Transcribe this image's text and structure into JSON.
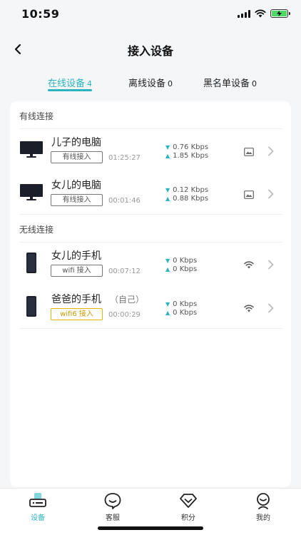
{
  "status_bar": {
    "time": "10:59"
  },
  "nav": {
    "title": "接入设备"
  },
  "tabs": [
    {
      "label": "在线设备",
      "count": "4",
      "active": true
    },
    {
      "label": "离线设备",
      "count": "0",
      "active": false
    },
    {
      "label": "黑名单设备",
      "count": "0",
      "active": false
    }
  ],
  "wired": {
    "title": "有线连接",
    "devices": [
      {
        "name": "儿子的电脑",
        "conn": "有线接入",
        "duration": "01:25:27",
        "down": "0.76 Kbps",
        "up": "1.85 Kbps",
        "icon": "desktop-icon",
        "type_icon": "picture-icon"
      },
      {
        "name": "女儿的电脑",
        "conn": "有线接入",
        "duration": "00:01:46",
        "down": "0.12 Kbps",
        "up": "0.88 Kbps",
        "icon": "desktop-icon",
        "type_icon": "picture-icon"
      }
    ]
  },
  "wireless": {
    "title": "无线连接",
    "devices": [
      {
        "name": "女儿的手机",
        "self_tag": "",
        "conn": "wifi 接入",
        "duration": "00:07:12",
        "down": "0 Kbps",
        "up": "0 Kbps",
        "icon": "phone-icon",
        "type_icon": "wifi-icon"
      },
      {
        "name": "爸爸的手机",
        "self_tag": "（自己）",
        "conn": "wifi6 接入",
        "duration": "00:00:29",
        "down": "0 Kbps",
        "up": "0 Kbps",
        "icon": "phone-icon",
        "type_icon": "wifi-icon"
      }
    ]
  },
  "bottom_tabs": [
    {
      "label": "设备",
      "icon": "router-icon",
      "active": true
    },
    {
      "label": "客服",
      "icon": "chat-icon",
      "active": false
    },
    {
      "label": "积分",
      "icon": "diamond-icon",
      "active": false
    },
    {
      "label": "我的",
      "icon": "profile-icon",
      "active": false
    }
  ],
  "colors": {
    "accent": "#2bb3c0",
    "badge_gold": "#e2b500",
    "battery": "#4cd964"
  }
}
